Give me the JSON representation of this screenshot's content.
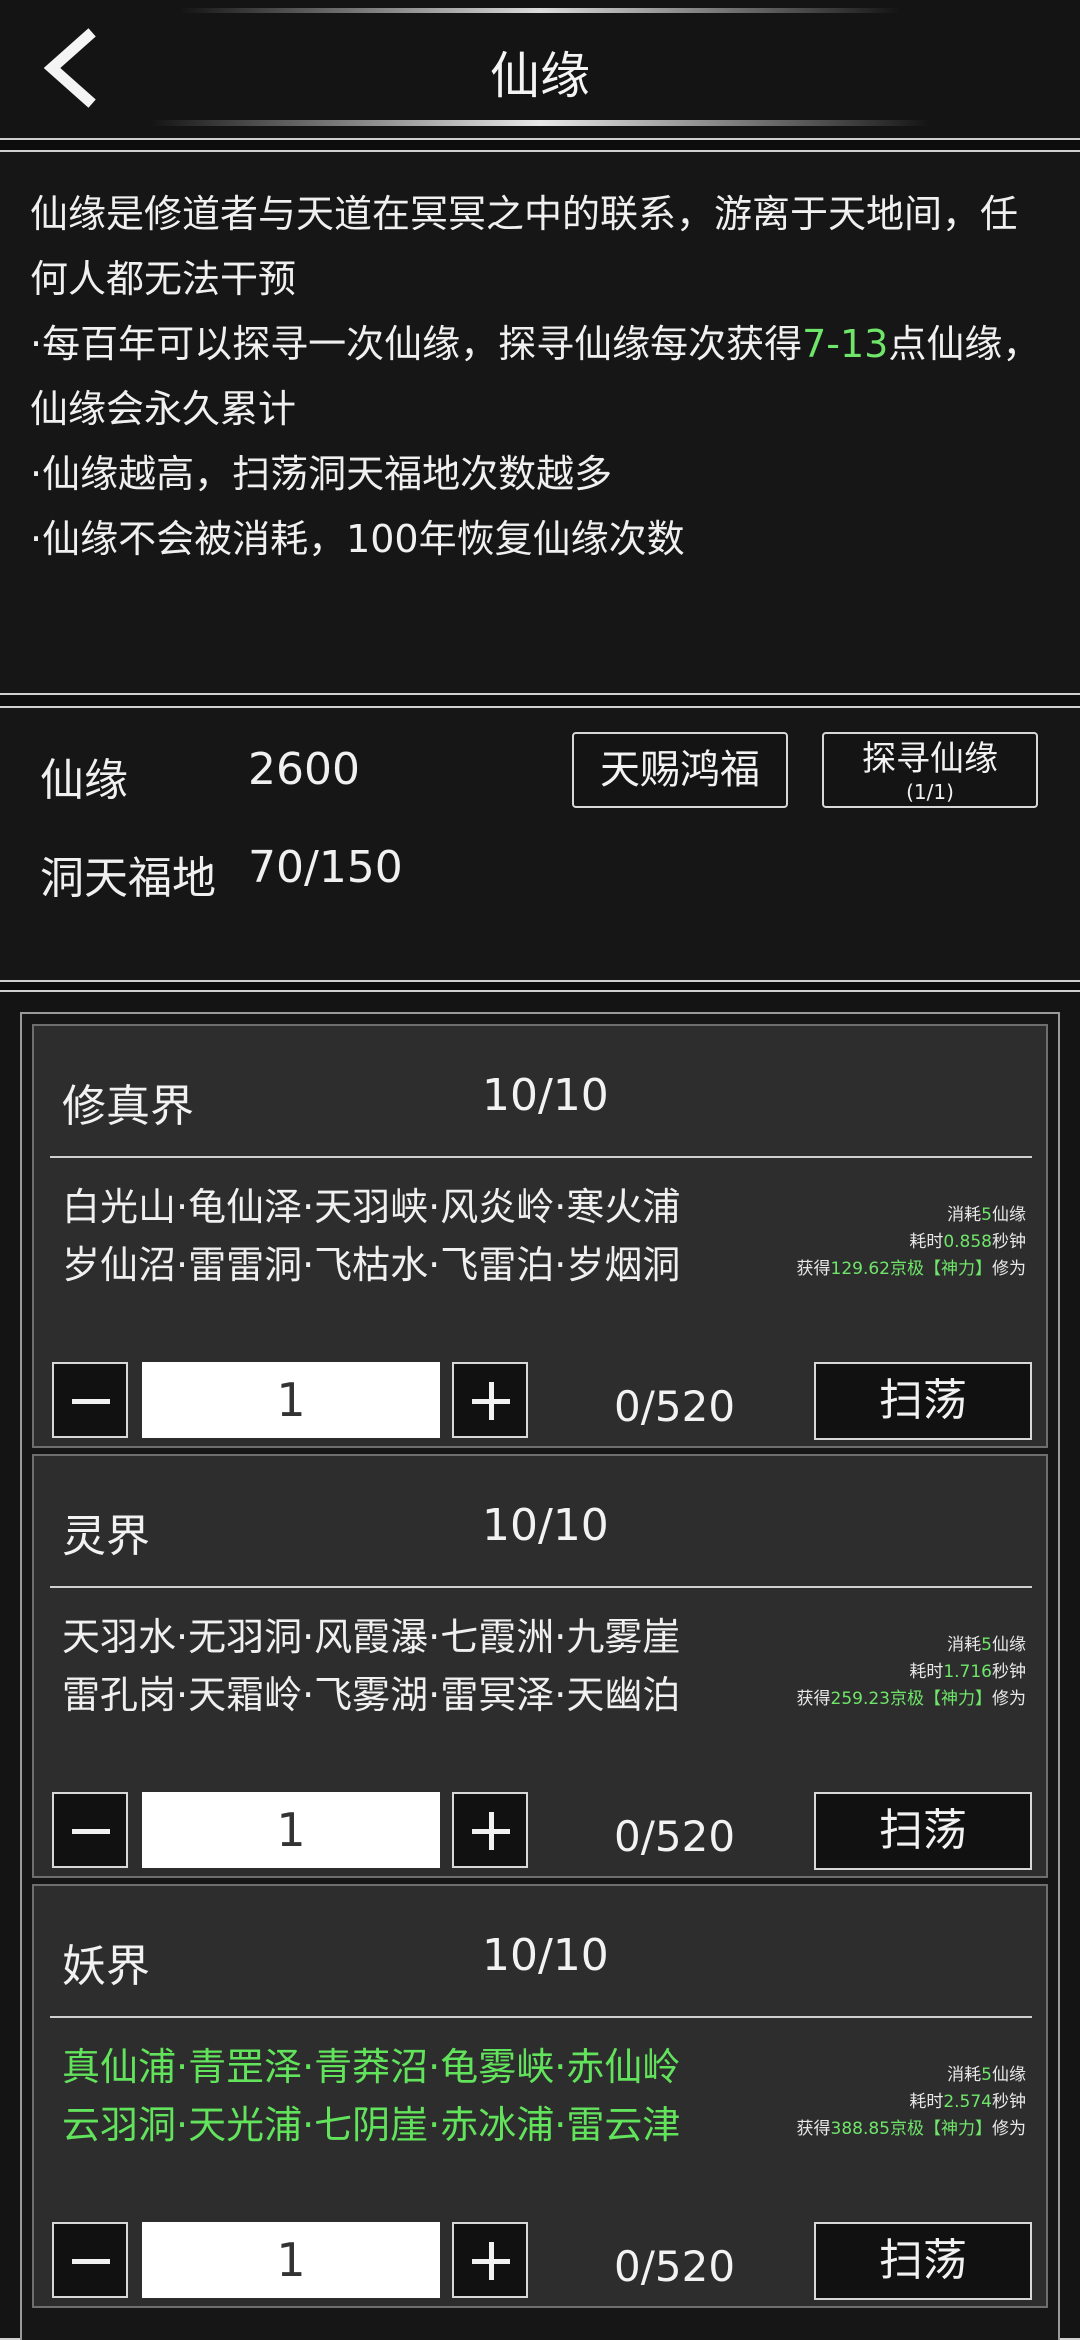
{
  "header": {
    "title": "仙缘"
  },
  "intro": {
    "line1": "仙缘是修道者与天道在冥冥之中的联系，游离于天地间，任何人都无法干预",
    "line2_pre": "·每百年可以探寻一次仙缘，探寻仙缘每次获得",
    "line2_hl": "7-13",
    "line2_post": "点仙缘，仙缘会永久累计",
    "line3": "·仙缘越高，扫荡洞天福地次数越多",
    "line4": "·仙缘不会被消耗，100年恢复仙缘次数"
  },
  "status": {
    "xianyuan_label": "仙缘",
    "xianyuan_value": "2600",
    "dongtian_label": "洞天福地",
    "dongtian_value": "70/150",
    "gift_button": "天赐鸿福",
    "seek_button": "探寻仙缘",
    "seek_sub": "(1/1)"
  },
  "realms": [
    {
      "name": "修真界",
      "progress": "10/10",
      "locations_line1": "白光山·龟仙泽·天羽峡·风炎岭·寒火浦",
      "locations_line2": "岁仙沼·雷雷洞·飞枯水·飞雷泊·岁烟洞",
      "cost_pre": "消耗",
      "cost_num": "5",
      "cost_post": "仙缘",
      "time_pre": "耗时",
      "time_num": "0.858",
      "time_post": "秒钟",
      "gain_pre": "获得",
      "gain_num": "129.62京极【神力】",
      "gain_post": "修为",
      "quantity": "1",
      "count": "0/520",
      "sweep": "扫荡"
    },
    {
      "name": "灵界",
      "progress": "10/10",
      "locations_line1": "天羽水·无羽洞·风霞瀑·七霞洲·九雾崖",
      "locations_line2": "雷孔岗·天霜岭·飞雾湖·雷冥泽·天幽泊",
      "cost_pre": "消耗",
      "cost_num": "5",
      "cost_post": "仙缘",
      "time_pre": "耗时",
      "time_num": "1.716",
      "time_post": "秒钟",
      "gain_pre": "获得",
      "gain_num": "259.23京极【神力】",
      "gain_post": "修为",
      "quantity": "1",
      "count": "0/520",
      "sweep": "扫荡"
    },
    {
      "name": "妖界",
      "progress": "10/10",
      "locations_line1": "真仙浦·青罡泽·青莽沼·龟雾峡·赤仙岭",
      "locations_line2": "云羽洞·天光浦·七阴崖·赤冰浦·雷云津",
      "cost_pre": "消耗",
      "cost_num": "5",
      "cost_post": "仙缘",
      "time_pre": "耗时",
      "time_num": "2.574",
      "time_post": "秒钟",
      "gain_pre": "获得",
      "gain_num": "388.85京极【神力】",
      "gain_post": "修为",
      "quantity": "1",
      "count": "0/520",
      "sweep": "扫荡"
    }
  ],
  "colors": {
    "highlight_green": "#6fe66a",
    "background": "#161616",
    "card": "#2d2d2d"
  }
}
